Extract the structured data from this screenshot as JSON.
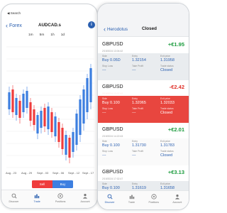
{
  "left": {
    "status": "◀ Search",
    "back_label": "Forex",
    "symbol": "AUDCAD.s",
    "timeframes": [
      "1m",
      "5m",
      "1h",
      "1d"
    ],
    "x_labels": [
      "Aug - 23",
      "Aug - 29",
      "Sept - 03",
      "Sept - 06",
      "Sept - 12",
      "Sept - 17"
    ],
    "sell_label": "Sell",
    "buy_label": "Buy",
    "tabs": [
      {
        "label": "Discover",
        "icon": "search-icon"
      },
      {
        "label": "Trade",
        "icon": "trade-icon"
      },
      {
        "label": "Positions",
        "icon": "positions-icon"
      },
      {
        "label": "Account",
        "icon": "account-icon"
      }
    ],
    "colors": {
      "bull": "#3d7fe0",
      "bear": "#ef3c3c",
      "accent": "#2a5fb0"
    }
  },
  "right": {
    "back_label": "Herodotus",
    "title": "Closed",
    "trades": [
      {
        "symbol": "GBPUSD",
        "pnl": "+€1.95",
        "date": "2/19/2024 13:04:42",
        "side_label": "Side",
        "side": "Buy 0.05D",
        "entry_label": "Entry",
        "entry": "1.32154",
        "exit_label": "Exit price",
        "exit": "1.31958",
        "sl_label": "Stop Loss",
        "sl": "---",
        "tp_label": "Take Profit",
        "tp": "---",
        "status_label": "Trade status",
        "status": "Closed",
        "variant": "grey"
      },
      {
        "symbol": "GBPUSD",
        "pnl": "-€2.42",
        "date": "2/19/2024 13:07:42",
        "side_label": "Side",
        "side": "Buy 0.100",
        "entry_label": "Entry",
        "entry": "1.32065",
        "exit_label": "Exit price",
        "exit": "1.32033",
        "sl_label": "Stop Loss",
        "sl": "---",
        "tp_label": "Take Profit",
        "tp": "---",
        "status_label": "Trade status",
        "status": "Closed",
        "variant": "loss"
      },
      {
        "symbol": "GBPUSD",
        "pnl": "+€2.01",
        "date": "2/19/2024 14:22:43",
        "side_label": "Side",
        "side": "Buy 0.100",
        "entry_label": "Entry",
        "entry": "1.31730",
        "exit_label": "Exit price",
        "exit": "1.31783",
        "sl_label": "Stop Loss",
        "sl": "---",
        "tp_label": "Take Profit",
        "tp": "---",
        "status_label": "Trade status",
        "status": "Closed",
        "variant": "white"
      },
      {
        "symbol": "GBPUSD",
        "pnl": "+€3.13",
        "date": "2/19/2024 17:02:47",
        "side_label": "Side",
        "side": "Buy 0.100",
        "entry_label": "Entry",
        "entry": "1.31619",
        "exit_label": "Exit price",
        "exit": "1.31658",
        "sl_label": "Stop Loss",
        "sl": "---",
        "tp_label": "Take Profit",
        "tp": "---",
        "status_label": "Trade status",
        "status": "",
        "variant": "grey"
      }
    ],
    "tabs": [
      {
        "label": "Discover",
        "icon": "search-icon"
      },
      {
        "label": "Trade",
        "icon": "trade-icon"
      },
      {
        "label": "Positions",
        "icon": "positions-icon"
      },
      {
        "label": "Account",
        "icon": "account-icon"
      }
    ]
  }
}
